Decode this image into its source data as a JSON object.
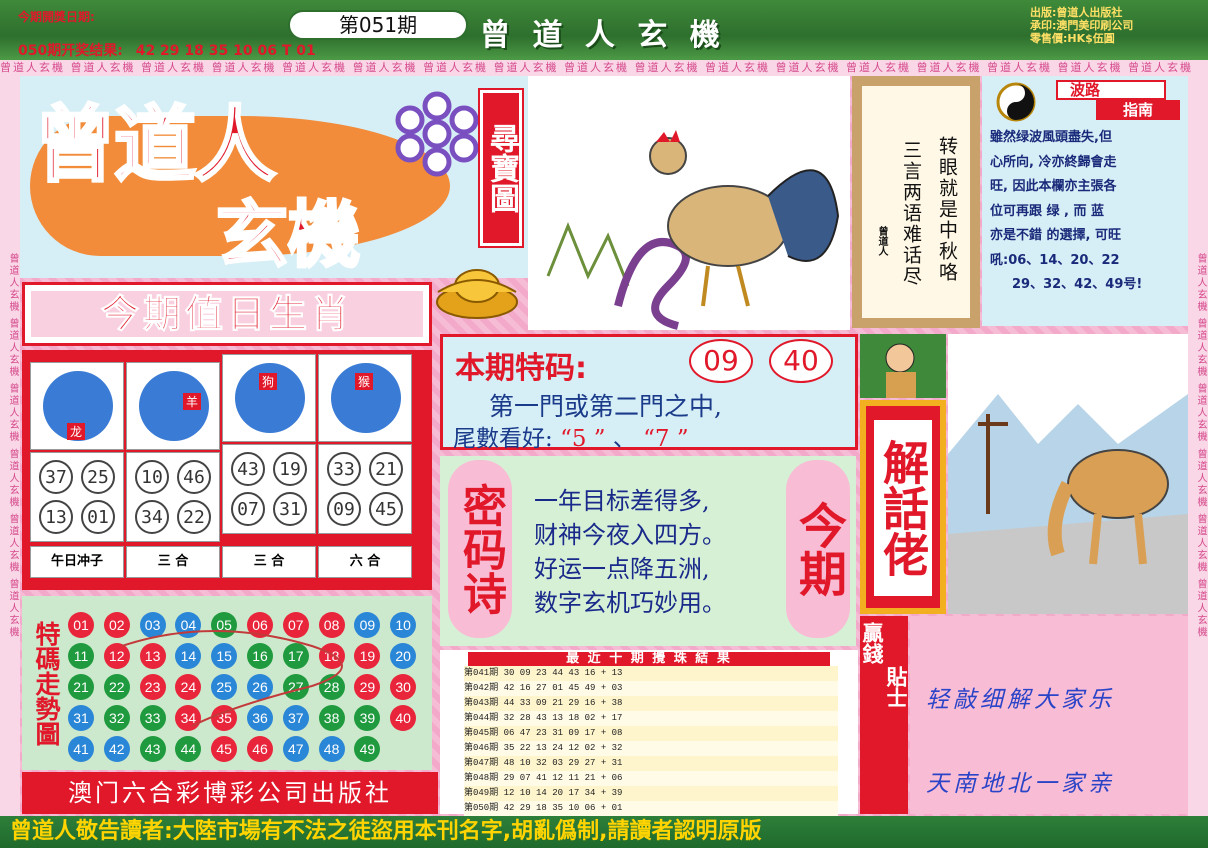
{
  "header": {
    "open_date_label": "今期開獎日期:",
    "last_result_label": "050期开奖结果:",
    "last_result_numbers": "42 29 18 35 10 06 T 01",
    "issue": "第051期",
    "brand": "曾 道 人 玄 機",
    "publisher_lines": [
      "出版:曾道人出版社",
      "承印:澳門美印刷公司",
      "零售價:HK$伍圓"
    ]
  },
  "ticker": "曾道人玄機 曾道人玄機 曾道人玄機 曾道人玄機 曾道人玄機 曾道人玄機 曾道人玄機 曾道人玄機 曾道人玄機 曾道人玄機 曾道人玄機 曾道人玄機 曾道人玄機 曾道人玄機 曾道人玄機 曾道人玄機 曾道人玄機",
  "side_text": "曾道人玄機 曾道人玄機 曾道人玄機 曾道人玄機 曾道人玄機 曾道人玄機",
  "logo": {
    "line1": "曾道人",
    "line2": "玄機",
    "seal": "尋寶圖"
  },
  "zodiac": {
    "title": "今期值日生肖",
    "animals": [
      {
        "name": "龙",
        "nums": [
          "37",
          "25",
          "13",
          "01"
        ],
        "note": "午日冲子"
      },
      {
        "name": "羊",
        "nums": [
          "10",
          "46",
          "34",
          "22"
        ],
        "note": "三 合"
      },
      {
        "name": "狗",
        "nums": [
          "43",
          "19",
          "07",
          "31"
        ],
        "note": "三 合"
      },
      {
        "name": "猴",
        "nums": [
          "33",
          "21",
          "09",
          "45"
        ],
        "note": "六 合"
      }
    ]
  },
  "poem_panel": {
    "col1": "转眼就是中秋咯",
    "col2": "三言两语难话尽",
    "sign": "曾道人"
  },
  "guide": {
    "title1": "波路",
    "title2": "指南",
    "lines": [
      "雖然绿波風頭盡失,但",
      "心所向, 冷亦終歸會走",
      "旺, 因此本欄亦主張各",
      "位可再跟 绿 , 而 蓝",
      "亦是不錯 的選擇, 可旺",
      "吼:06、14、20、22",
      "29、32、42、49号!"
    ]
  },
  "special": {
    "label": "本期特码:",
    "numbers": [
      "09",
      "40"
    ],
    "line1": "第一門或第二門之中,",
    "line2_prefix": "尾數看好:",
    "tail1": "“5 ”",
    "sep": "、",
    "tail2": "“7 ”"
  },
  "secret_poem": {
    "left_label": "密码诗",
    "right_label": "今期",
    "lines": [
      "一年目标差得多,",
      "财神今夜入四方。",
      "好运一点降五洲,",
      "数字玄机巧妙用。"
    ]
  },
  "jie_hua": "解話佬",
  "special_trend": {
    "label": "特碼走勢圖",
    "balls": [
      [
        "01",
        "r"
      ],
      [
        "02",
        "r"
      ],
      [
        "03",
        "b"
      ],
      [
        "04",
        "b"
      ],
      [
        "05",
        "g"
      ],
      [
        "06",
        "r"
      ],
      [
        "07",
        "r"
      ],
      [
        "08",
        "r"
      ],
      [
        "09",
        "b"
      ],
      [
        "10",
        "b"
      ],
      [
        "11",
        "g"
      ],
      [
        "12",
        "r"
      ],
      [
        "13",
        "r"
      ],
      [
        "14",
        "b"
      ],
      [
        "15",
        "b"
      ],
      [
        "16",
        "g"
      ],
      [
        "17",
        "g"
      ],
      [
        "18",
        "r"
      ],
      [
        "19",
        "r"
      ],
      [
        "20",
        "b"
      ],
      [
        "21",
        "g"
      ],
      [
        "22",
        "g"
      ],
      [
        "23",
        "r"
      ],
      [
        "24",
        "r"
      ],
      [
        "25",
        "b"
      ],
      [
        "26",
        "b"
      ],
      [
        "27",
        "g"
      ],
      [
        "28",
        "g"
      ],
      [
        "29",
        "r"
      ],
      [
        "30",
        "r"
      ],
      [
        "31",
        "b"
      ],
      [
        "32",
        "g"
      ],
      [
        "33",
        "g"
      ],
      [
        "34",
        "r"
      ],
      [
        "35",
        "r"
      ],
      [
        "36",
        "b"
      ],
      [
        "37",
        "b"
      ],
      [
        "38",
        "g"
      ],
      [
        "39",
        "g"
      ],
      [
        "40",
        "r"
      ],
      [
        "41",
        "b"
      ],
      [
        "42",
        "b"
      ],
      [
        "43",
        "g"
      ],
      [
        "44",
        "g"
      ],
      [
        "45",
        "r"
      ],
      [
        "46",
        "r"
      ],
      [
        "47",
        "b"
      ],
      [
        "48",
        "b"
      ],
      [
        "49",
        "g"
      ]
    ]
  },
  "footer_company": "澳门六合彩博彩公司出版社",
  "results": {
    "title": "最 近 十 期 攪 珠 結 果",
    "rows": [
      "第041期   30   09   23   44   43   16   +   13",
      "第042期   42   16   27   01   45   49   +   03",
      "第043期   44   33   09   21   29   16   +   38",
      "第044期   32   28   43   13   18   02   +   17",
      "第045期   06   47   23   31   09   17   +   08",
      "第046期   35   22   13   24   12   02   +   32",
      "第047期   48   10   32   03   29   27   +   31",
      "第048期   29   07   41   12   11   21   +   06",
      "第049期   12   10   14   20   17   34   +   39",
      "第050期   42   29   18   35   10   06   +   01"
    ]
  },
  "tips": {
    "label1": "贏錢",
    "label2": "貼士",
    "line1": "轻敲细解大家乐",
    "line2": "天南地北一家亲"
  },
  "bottom_banner": "曾道人敬告讀者:大陸市場有不法之徒盜用本刊名字,胡亂僞制,請讀者認明原版"
}
